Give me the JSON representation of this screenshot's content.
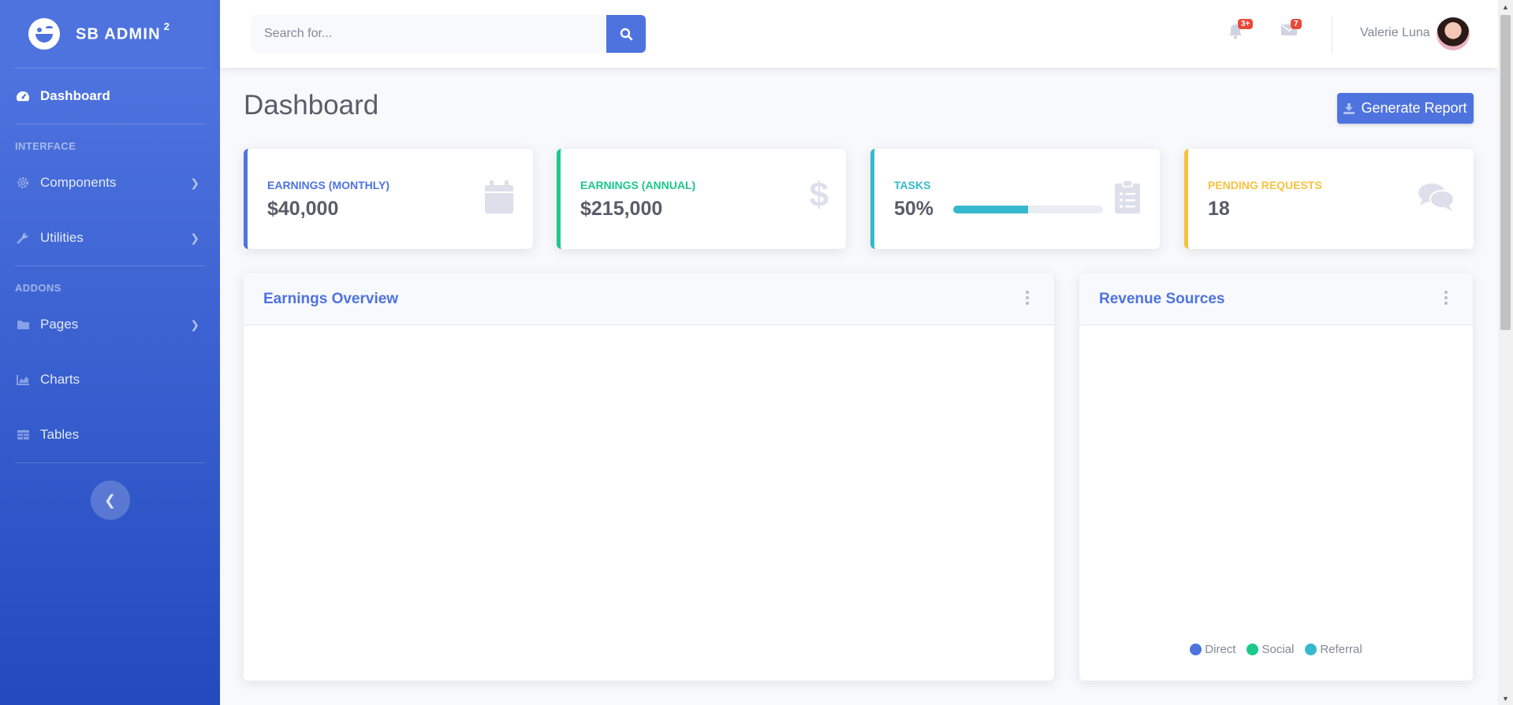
{
  "brand": {
    "name": "SB ADMIN",
    "version": "2"
  },
  "sidebar": {
    "dashboard": "Dashboard",
    "heading_interface": "INTERFACE",
    "components": "Components",
    "utilities": "Utilities",
    "heading_addons": "ADDONS",
    "pages": "Pages",
    "charts": "Charts",
    "tables": "Tables"
  },
  "search": {
    "placeholder": "Search for..."
  },
  "topbar": {
    "alerts_badge": "3+",
    "messages_badge": "7",
    "user_name": "Valerie Luna"
  },
  "page": {
    "title": "Dashboard",
    "generate_report": "Generate Report"
  },
  "cards": {
    "earnings_monthly": {
      "label": "EARNINGS (MONTHLY)",
      "value": "$40,000",
      "color": "#4e73df"
    },
    "earnings_annual": {
      "label": "EARNINGS (ANNUAL)",
      "value": "$215,000",
      "color": "#1cc88a"
    },
    "tasks": {
      "label": "TASKS",
      "value": "50%",
      "progress": 0.5,
      "color": "#36b9cc"
    },
    "pending": {
      "label": "PENDING REQUESTS",
      "value": "18",
      "color": "#f6c23e"
    }
  },
  "earnings_panel": {
    "title": "Earnings Overview"
  },
  "revenue_panel": {
    "title": "Revenue Sources",
    "legend": [
      {
        "label": "Direct",
        "color": "#4e73df"
      },
      {
        "label": "Social",
        "color": "#1cc88a"
      },
      {
        "label": "Referral",
        "color": "#36b9cc"
      }
    ]
  }
}
